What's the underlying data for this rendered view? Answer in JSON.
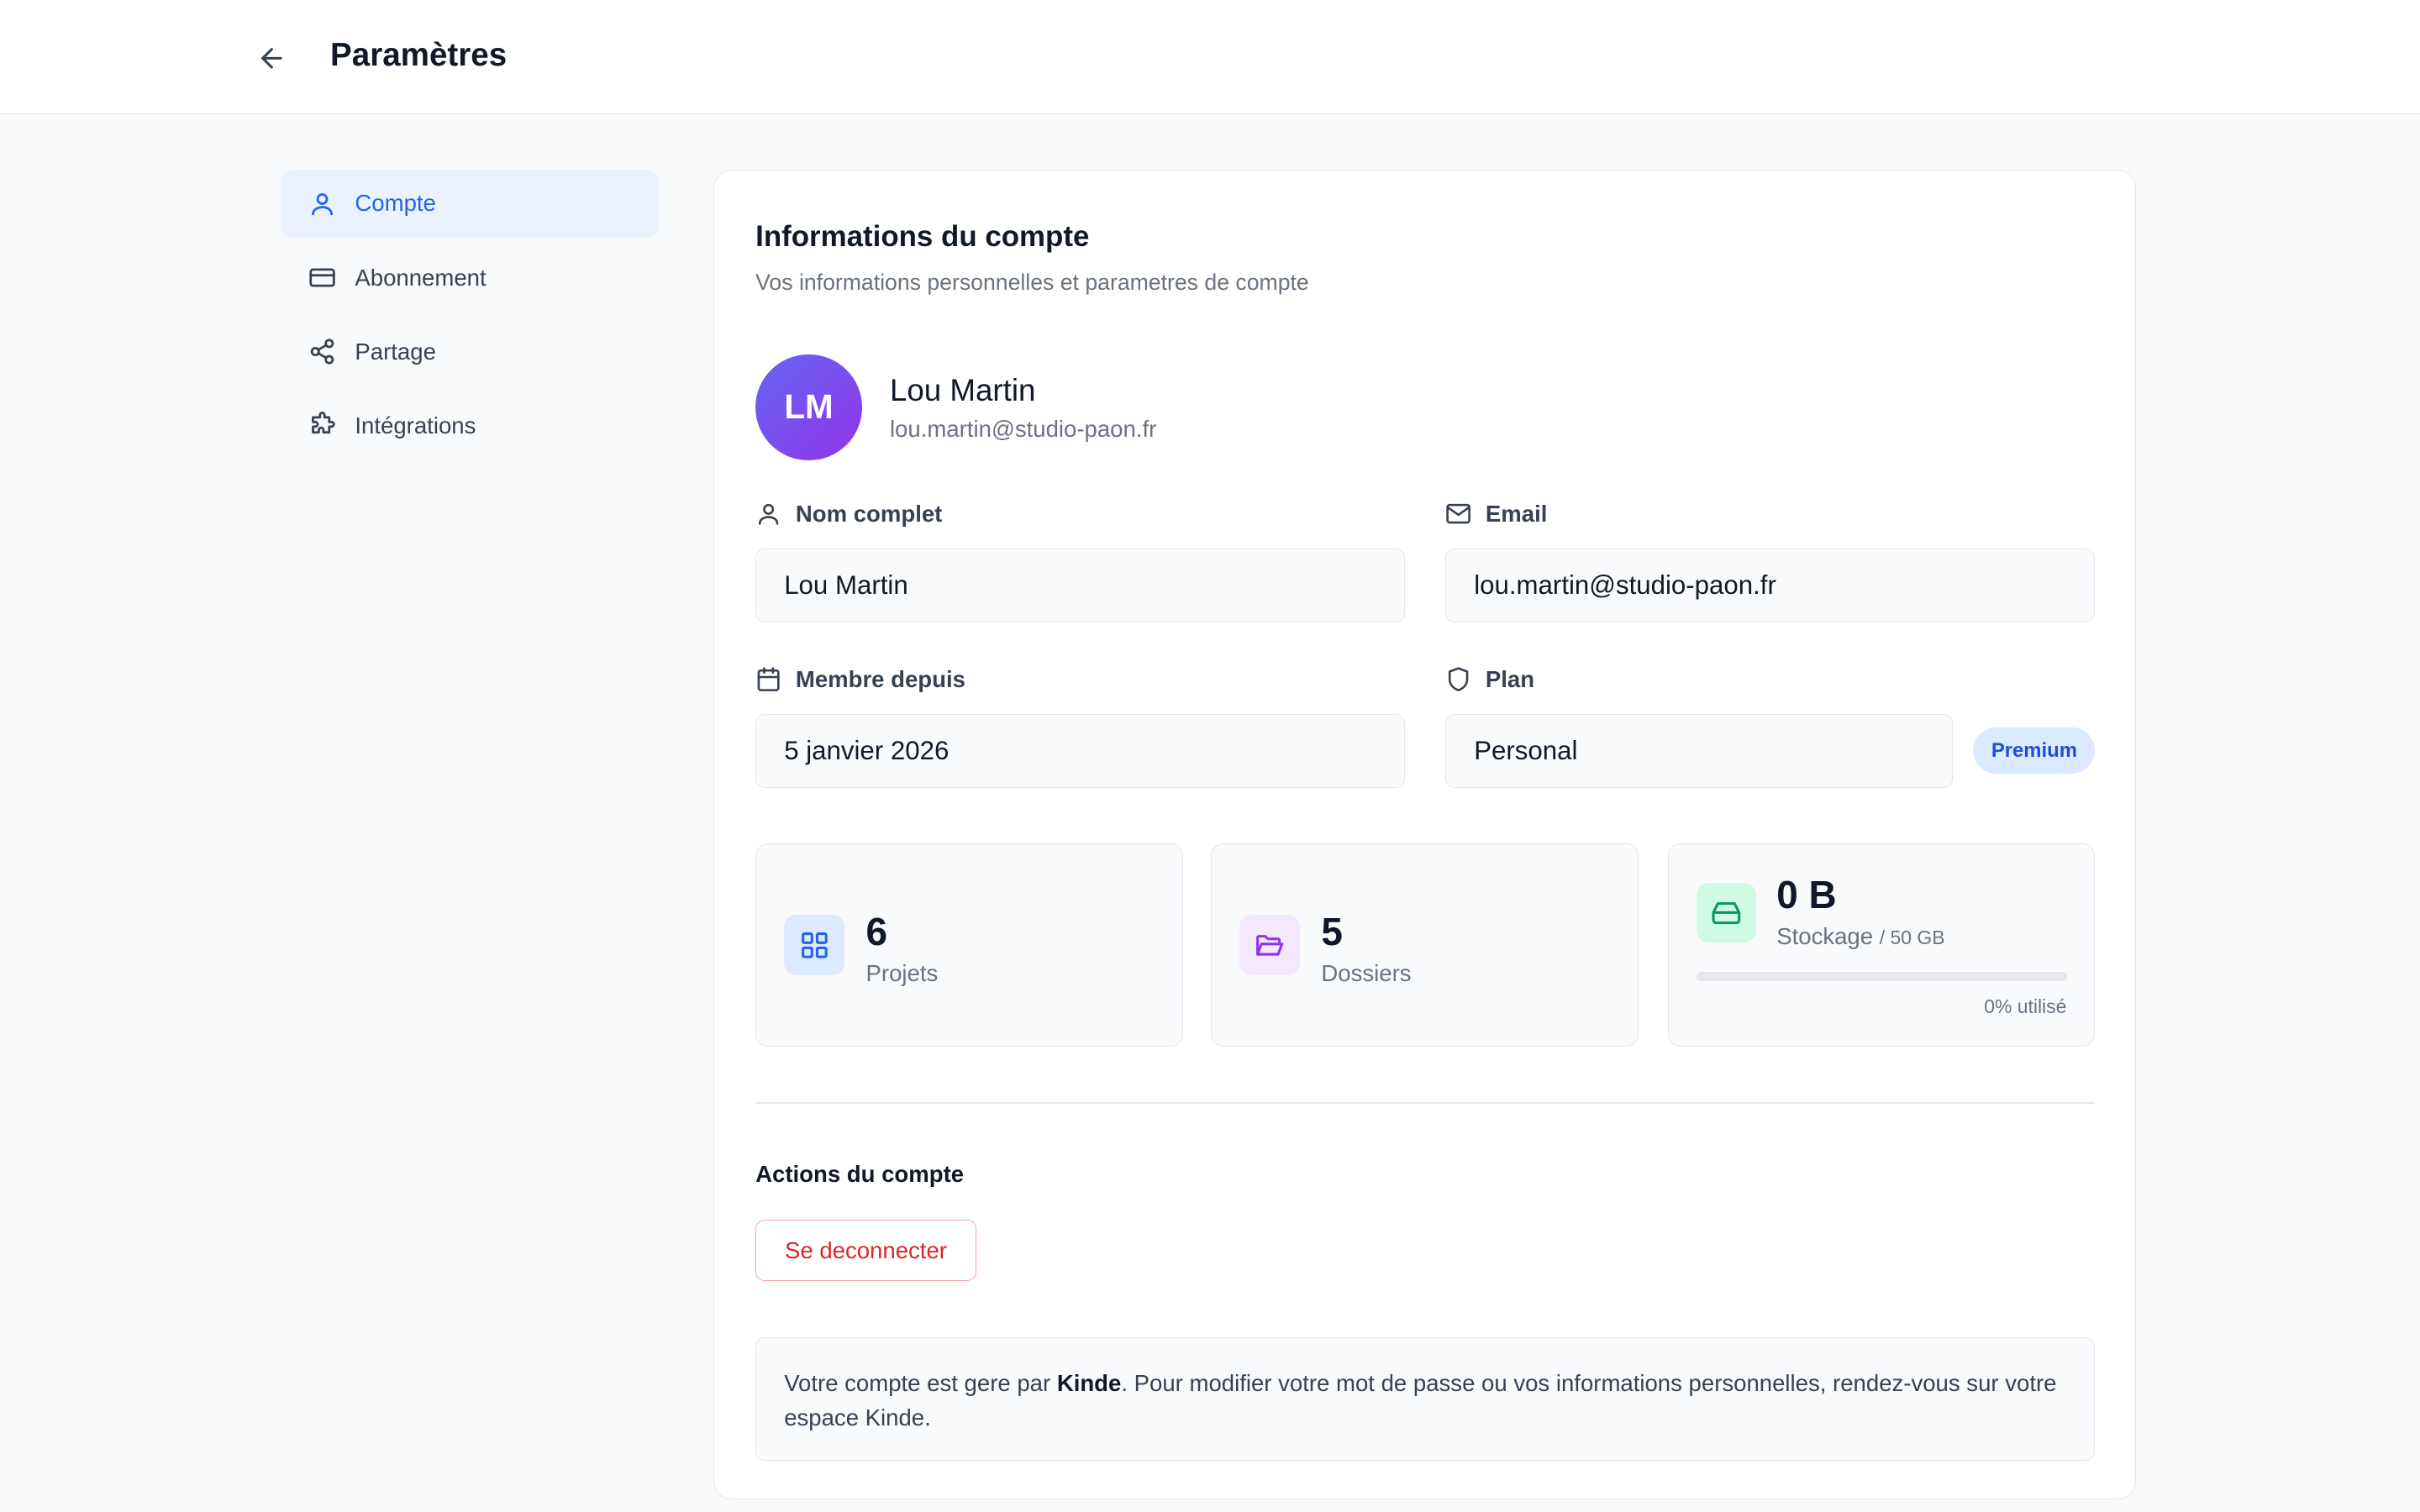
{
  "header": {
    "title": "Paramètres",
    "back_icon": "arrow-left-icon"
  },
  "sidebar": {
    "items": [
      {
        "label": "Compte",
        "icon": "user-icon",
        "active": true
      },
      {
        "label": "Abonnement",
        "icon": "credit-card-icon",
        "active": false
      },
      {
        "label": "Partage",
        "icon": "share-icon",
        "active": false
      },
      {
        "label": "Intégrations",
        "icon": "puzzle-icon",
        "active": false
      }
    ]
  },
  "account": {
    "title": "Informations du compte",
    "subtitle": "Vos informations personnelles et parametres de compte",
    "initials": "LM",
    "name": "Lou Martin",
    "email": "lou.martin@studio-paon.fr"
  },
  "fields": {
    "name_label": "Nom complet",
    "name_value": "Lou Martin",
    "email_label": "Email",
    "email_value": "lou.martin@studio-paon.fr",
    "member_label": "Membre depuis",
    "member_value": "5 janvier 2026",
    "plan_label": "Plan",
    "plan_value": "Personal",
    "plan_badge": "Premium"
  },
  "stats": {
    "projects_value": "6",
    "projects_label": "Projets",
    "folders_value": "5",
    "folders_label": "Dossiers",
    "storage_value": "0 B",
    "storage_label": "Stockage",
    "storage_total": "/ 50 GB",
    "storage_used_fraction": 0,
    "storage_used_text": "0% utilisé"
  },
  "actions": {
    "title": "Actions du compte",
    "logout_label": "Se deconnecter"
  },
  "note": {
    "prefix": "Votre compte est gere par ",
    "provider": "Kinde",
    "suffix": ". Pour modifier votre mot de passe ou vos informations personnelles, rendez-vous sur votre espace Kinde."
  },
  "colors": {
    "accent": "#2563eb",
    "danger": "#dc2626",
    "storage": "#10b981",
    "folder": "#9333ea"
  }
}
